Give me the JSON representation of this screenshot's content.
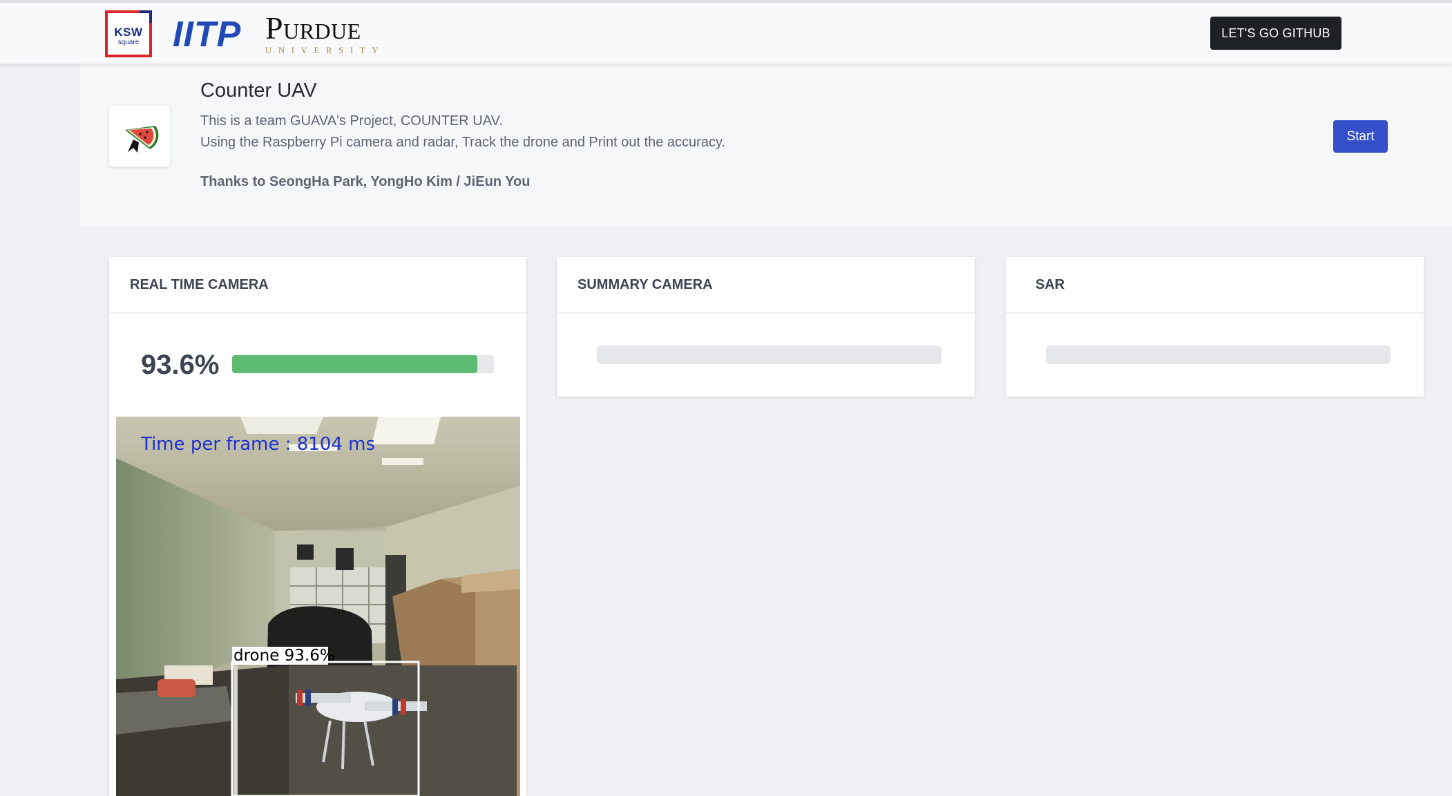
{
  "navbar": {
    "logos": {
      "ksw_line1": "KSW",
      "ksw_line2": "square",
      "iitp": "IITP",
      "purdue": "Purdue",
      "purdue_sub": "UNIVERSITY"
    },
    "github_button": "LET'S GO GITHUB"
  },
  "hero": {
    "title": "Counter UAV",
    "description_line1": "This is a team GUAVA's Project, COUNTER UAV.",
    "description_line2": "Using the Raspberry Pi camera and radar, Track the drone and Print out the accuracy.",
    "thanks": "Thanks to SeongHa Park, YongHo Kim / JiEun You",
    "start_button": "Start",
    "avatar_icon": "watermelon-icon"
  },
  "cards": {
    "realtime": {
      "title": "REAL TIME CAMERA",
      "accuracy_label": "93.6%",
      "accuracy_fraction": 0.936,
      "progress_color": "#5dbb72",
      "frame_overlay": "Time per frame : 8104 ms",
      "detection_label": "drone 93.6%"
    },
    "summary": {
      "title": "SUMMARY CAMERA",
      "loading": true
    },
    "sar": {
      "title": "SAR",
      "loading": true
    }
  },
  "colors": {
    "accent": "#3450c9",
    "dark_button": "#1e2124",
    "page_background": "#eff0f4"
  }
}
